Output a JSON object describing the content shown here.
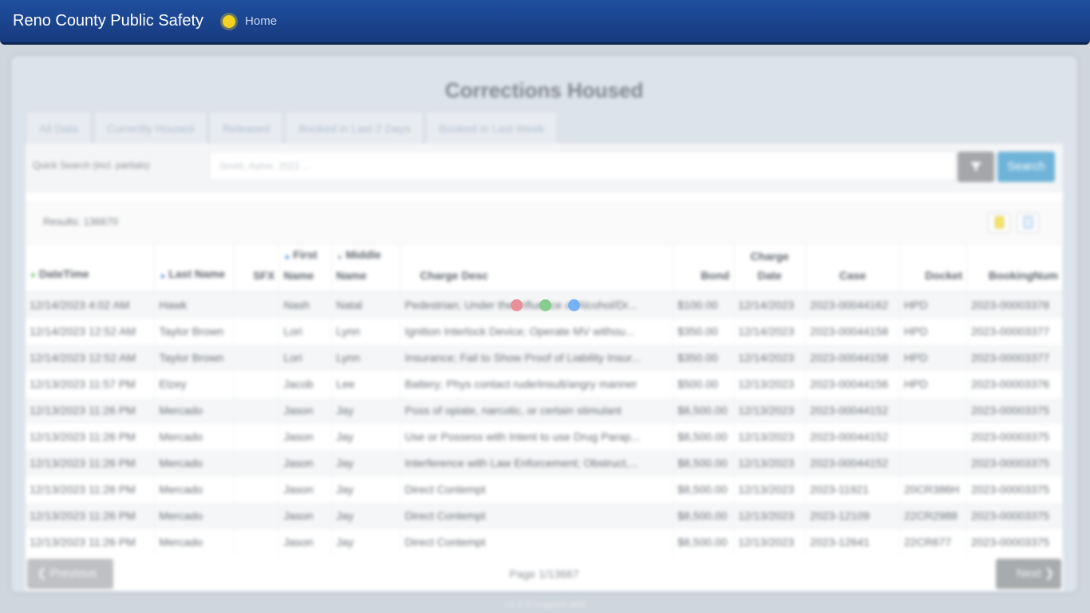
{
  "navbar": {
    "brand": "Reno County Public Safety",
    "home_label": "Home",
    "brand_color": "#1f4f9f",
    "sun_icon": "sun-icon"
  },
  "page": {
    "title": "Corrections Housed",
    "tabs": [
      "All Data",
      "Currently Housed",
      "Released",
      "Booked in Last 2 Days",
      "Booked in Last Week"
    ]
  },
  "search": {
    "label": "Quick Search (incl. partials)",
    "placeholder": "Smith, Asher, 2021 ...",
    "search_label": "Search",
    "filter_icon": "filter-icon"
  },
  "results": {
    "text": "Results: 136670",
    "export_icons": [
      "excel-export-icon",
      "document-export-icon"
    ]
  },
  "table": {
    "headers": [
      {
        "label": "DateTime",
        "sort": "down"
      },
      {
        "label": "Last Name",
        "sort": "up"
      },
      {
        "label": "SFX",
        "sort": ""
      },
      {
        "label": "First Name",
        "sort": "up"
      },
      {
        "label": "Middle Name",
        "sort": "grey"
      },
      {
        "label": "Charge Desc",
        "sort": ""
      },
      {
        "label": "Bond",
        "sort": ""
      },
      {
        "label": "Charge Date",
        "sort": ""
      },
      {
        "label": "Case",
        "sort": ""
      },
      {
        "label": "Docket",
        "sort": ""
      },
      {
        "label": "BookingNum",
        "sort": ""
      }
    ],
    "rows": [
      [
        "12/14/2023 4:02 AM",
        "Hawk",
        "",
        "Nash",
        "Natal",
        "Pedestrian; Under the Influence of Alcohol/Dr...",
        "$100.00",
        "12/14/2023",
        "2023-00044162",
        "HPD",
        "2023-00003378"
      ],
      [
        "12/14/2023 12:52 AM",
        "Taylor Brown",
        "",
        "Lori",
        "Lynn",
        "Ignition Interlock Device; Operate MV withou...",
        "$350.00",
        "12/14/2023",
        "2023-00044158",
        "HPD",
        "2023-00003377"
      ],
      [
        "12/14/2023 12:52 AM",
        "Taylor Brown",
        "",
        "Lori",
        "Lynn",
        "Insurance; Fail to Show Proof of Liability Insur...",
        "$350.00",
        "12/14/2023",
        "2023-00044158",
        "HPD",
        "2023-00003377"
      ],
      [
        "12/13/2023 11:57 PM",
        "Elzey",
        "",
        "Jacob",
        "Lee",
        "Battery; Phys contact rude/insult/angry manner",
        "$500.00",
        "12/13/2023",
        "2023-00044156",
        "HPD",
        "2023-00003376"
      ],
      [
        "12/13/2023 11:26 PM",
        "Mercado",
        "",
        "Jason",
        "Jay",
        "Poss of opiate, narcotic, or certain stimulant",
        "$8,500.00",
        "12/13/2023",
        "2023-00044152",
        "",
        "2023-00003375"
      ],
      [
        "12/13/2023 11:26 PM",
        "Mercado",
        "",
        "Jason",
        "Jay",
        "Use or Possess with Intent to use Drug Parap...",
        "$8,500.00",
        "12/13/2023",
        "2023-00044152",
        "",
        "2023-00003375"
      ],
      [
        "12/13/2023 11:26 PM",
        "Mercado",
        "",
        "Jason",
        "Jay",
        "Interference with Law Enforcement; Obstruct,...",
        "$8,500.00",
        "12/13/2023",
        "2023-00044152",
        "",
        "2023-00003375"
      ],
      [
        "12/13/2023 11:26 PM",
        "Mercado",
        "",
        "Jason",
        "Jay",
        "Direct Contempt",
        "$8,500.00",
        "12/13/2023",
        "2023-11921",
        "20CR386H",
        "2023-00003375"
      ],
      [
        "12/13/2023 11:26 PM",
        "Mercado",
        "",
        "Jason",
        "Jay",
        "Direct Contempt",
        "$8,500.00",
        "12/13/2023",
        "2023-12109",
        "22CR2988",
        "2023-00003375"
      ],
      [
        "12/13/2023 11:26 PM",
        "Mercado",
        "",
        "Jason",
        "Jay",
        "Direct Contempt",
        "$8,500.00",
        "12/13/2023",
        "2023-12641",
        "22CR677",
        "2023-00003375"
      ]
    ]
  },
  "pager": {
    "prev_label": "Previous",
    "next_label": "Next",
    "page_text": "Page 1/13667"
  },
  "footer": {
    "text": "v1.0 © support.add"
  },
  "loading": {
    "dot_colors": [
      "#e88f99",
      "#88cc8e",
      "#77b2f4"
    ]
  }
}
